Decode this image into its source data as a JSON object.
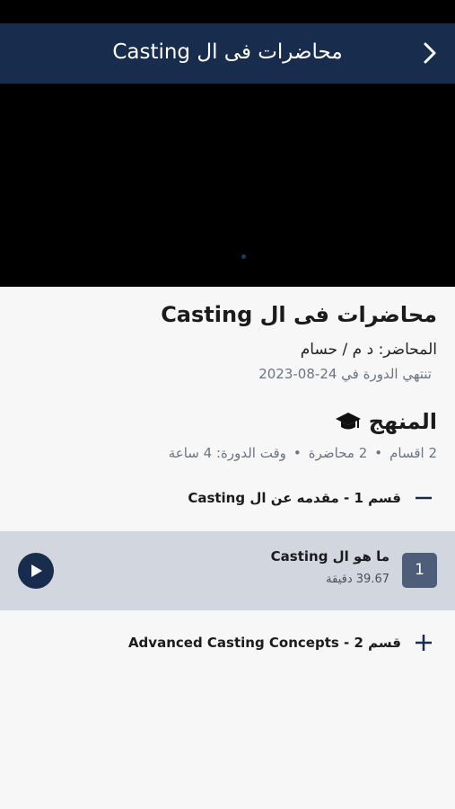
{
  "header": {
    "title": "محاضرات فى ال Casting",
    "back_icon": "chevron-right-icon"
  },
  "video": {
    "state": "loading"
  },
  "course": {
    "title": "محاضرات فى ال Casting",
    "lecturer": "المحاضر: د م / حسام",
    "end_date": "تنتهي الدورة في 24-08-2023"
  },
  "curriculum": {
    "heading": "المنهج",
    "icon": "graduation-cap-icon",
    "stats": {
      "sections": "2 اقسام",
      "lectures": "2 محاضرة",
      "duration": "وقت الدورة: 4 ساعة",
      "separator": "•"
    },
    "sections": [
      {
        "title": "قسم 1 - مقدمه عن ال Casting",
        "expanded": true,
        "toggle_icon": "minus-icon",
        "lessons": [
          {
            "number": "1",
            "title": "ما هو ال Casting",
            "duration": "39.67 دقيقة",
            "action_icon": "play-icon"
          }
        ]
      },
      {
        "title": "قسم 2 - Advanced Casting Concepts",
        "expanded": false,
        "toggle_icon": "plus-icon"
      }
    ]
  },
  "colors": {
    "primary": "#182c4d",
    "lesson_bg": "#d2d6de",
    "badge": "#4e5d78",
    "muted": "#6c7483"
  }
}
